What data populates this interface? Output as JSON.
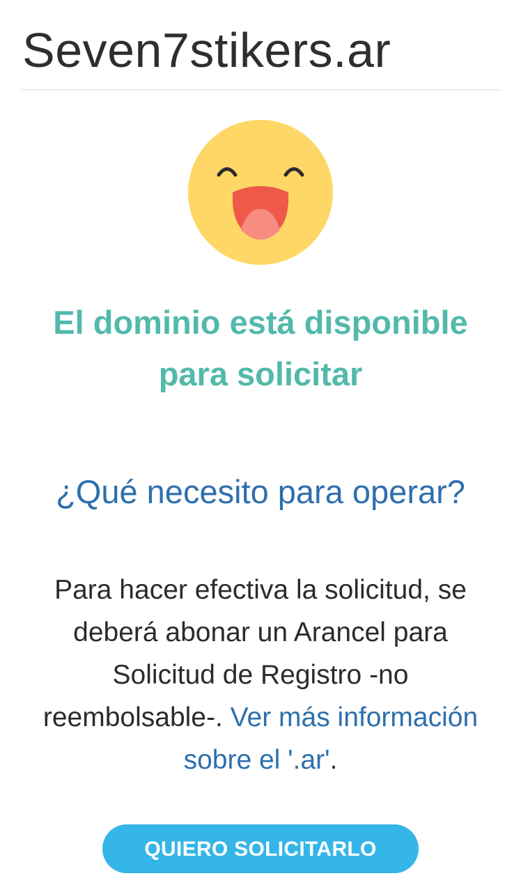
{
  "header": {
    "domain": "Seven7stikers.ar"
  },
  "status": {
    "icon": "laughing-face-icon",
    "message": "El dominio está disponible para solicitar"
  },
  "info": {
    "question": "¿Qué necesito para operar?",
    "text_before_link": "Para hacer efectiva la solicitud, se deberá abonar un Arancel para Solicitud de Registro -no reembolsable-. ",
    "link_label": "Ver más información sobre el '.ar'",
    "text_after_link": "."
  },
  "actions": {
    "request_label": "QUIERO SOLICITARLO"
  },
  "colors": {
    "status_green": "#52b9ab",
    "link_blue": "#2d6fad",
    "button_blue": "#35b6e8",
    "emoji_yellow": "#fed766",
    "mouth_red": "#ee5a4a",
    "tongue_pink": "#f78c80"
  }
}
